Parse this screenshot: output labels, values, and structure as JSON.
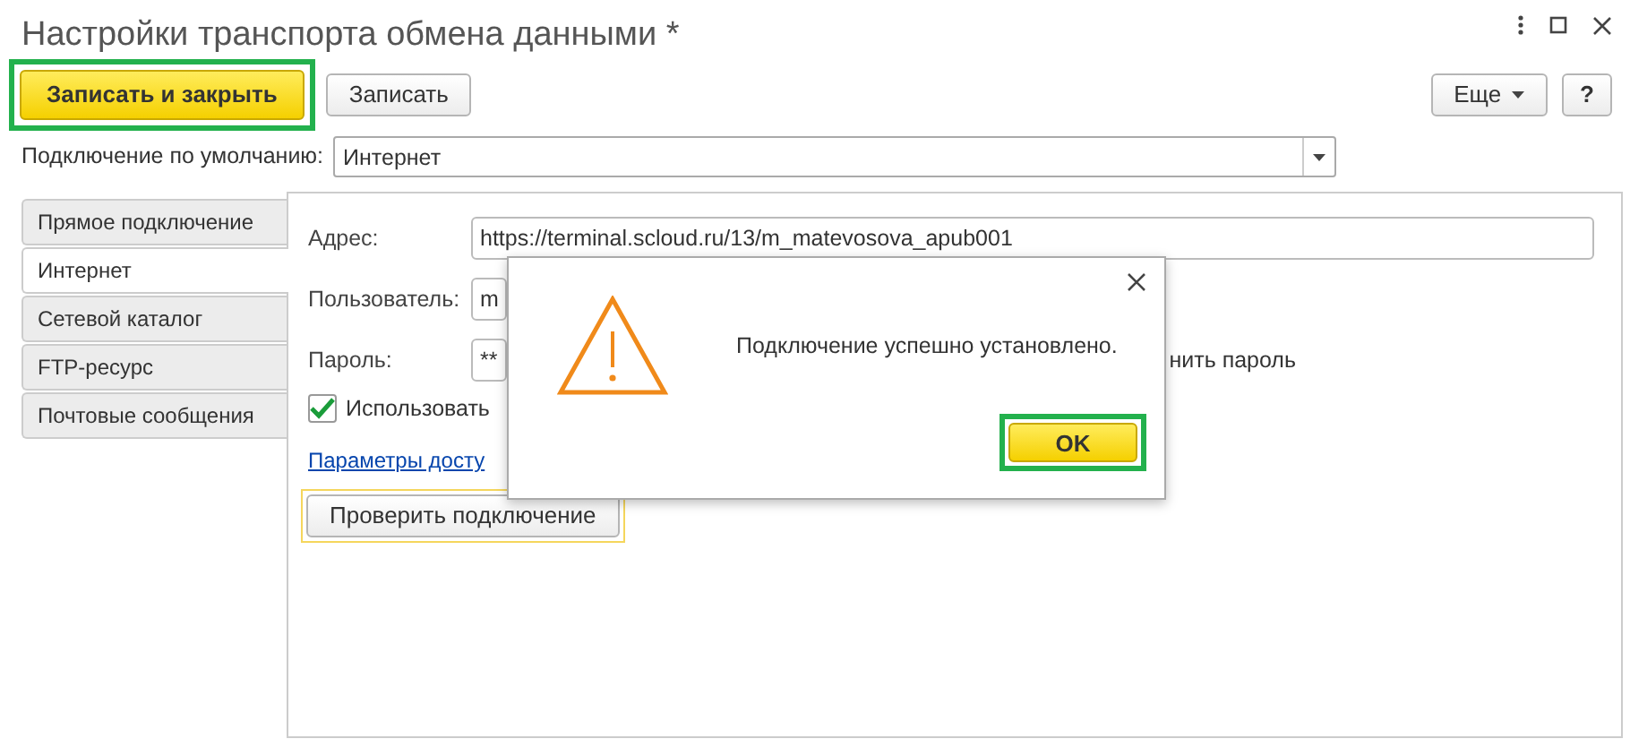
{
  "window": {
    "title": "Настройки транспорта обмена данными *"
  },
  "toolbar": {
    "buttons": [
      {
        "label": "Записать и закрыть",
        "kind": "primary",
        "highlighted": true
      },
      {
        "label": "Записать",
        "kind": "default"
      }
    ],
    "more": "Еще",
    "help": "?"
  },
  "default_connection": {
    "label": "Подключение по умолчанию:",
    "value": "Интернет"
  },
  "tabs": [
    {
      "label": "Прямое подключение",
      "selected": false
    },
    {
      "label": "Интернет",
      "selected": true
    },
    {
      "label": "Сетевой каталог",
      "selected": false
    },
    {
      "label": "FTP-ресурс",
      "selected": false
    },
    {
      "label": "Почтовые сообщения",
      "selected": false
    }
  ],
  "form": {
    "fields": [
      {
        "label": "Адрес:",
        "value": "https://terminal.scloud.ru/13/m_matevosova_apub001"
      },
      {
        "label": "Пользователь:",
        "value": "m"
      },
      {
        "label": "Пароль:",
        "value": "**"
      }
    ],
    "remember_fragment": "нить пароль",
    "use_checkbox": {
      "label": "Использовать",
      "checked": true
    },
    "link": "Параметры досту",
    "check_button": "Проверить подключение"
  },
  "dialog": {
    "message": "Подключение успешно установлено.",
    "ok": {
      "label": "OK",
      "highlighted": true
    }
  }
}
